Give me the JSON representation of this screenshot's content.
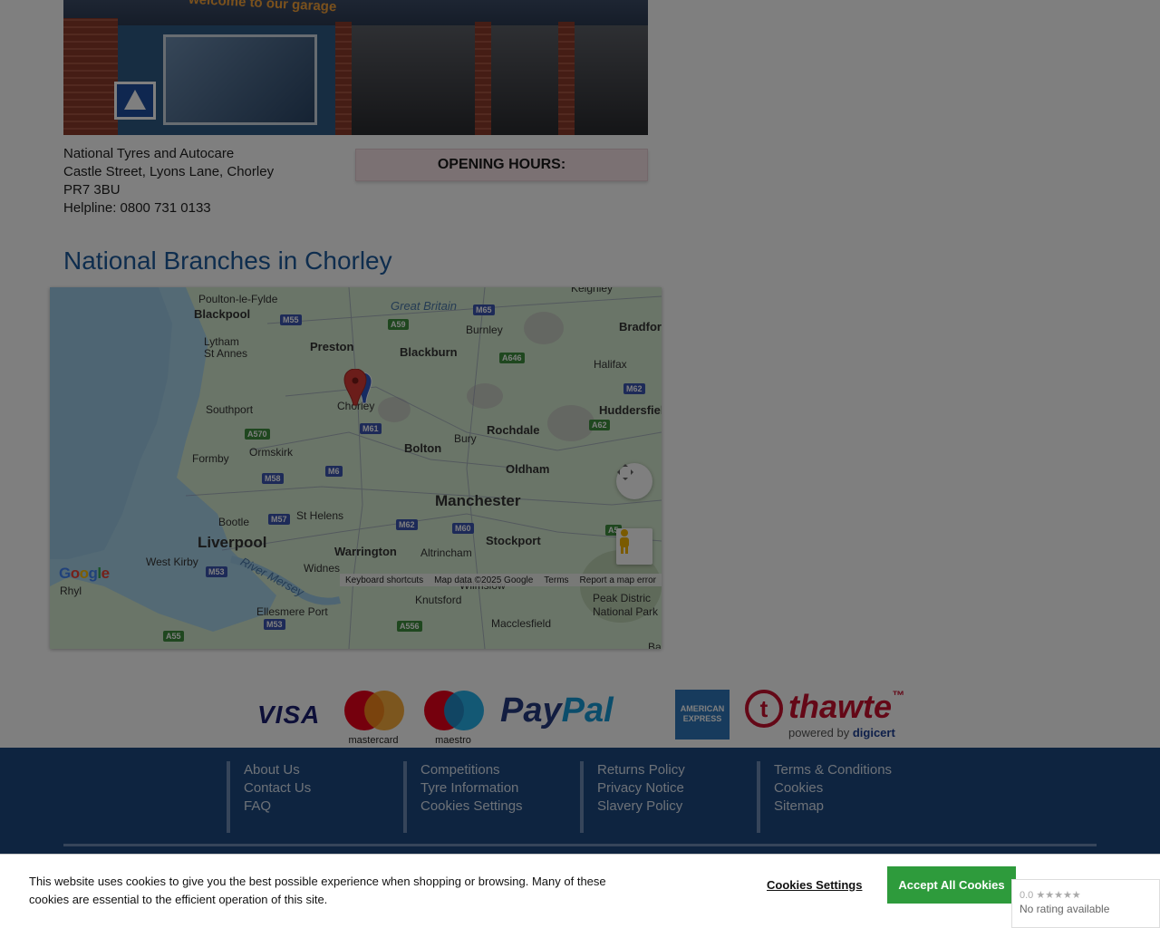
{
  "store": {
    "photo_sign": "welcome to our garage",
    "name": "National Tyres and Autocare",
    "street": "Castle Street, Lyons Lane, Chorley",
    "postcode": "PR7 3BU",
    "helpline": "Helpline: 0800 731 0133",
    "opening_hours_label": "OPENING HOURS:"
  },
  "branches_heading": "National Branches in Chorley",
  "map": {
    "places": {
      "poulton": "Poulton-le-Fylde",
      "great_britain": "Great Britain",
      "keighley": "Keighley",
      "blackpool": "Blackpool",
      "burnley": "Burnley",
      "bradford": "Bradford",
      "lytham": "Lytham\nSt Annes",
      "preston": "Preston",
      "blackburn": "Blackburn",
      "halifax": "Halifax",
      "southport": "Southport",
      "chorley": "Chorley",
      "huddersfield": "Huddersfiel",
      "rochdale": "Rochdale",
      "bury": "Bury",
      "ormskirk": "Ormskirk",
      "bolton": "Bolton",
      "formby": "Formby",
      "oldham": "Oldham",
      "manchester": "Manchester",
      "bootle": "Bootle",
      "st_helens": "St Helens",
      "liverpool": "Liverpool",
      "stockport": "Stockport",
      "warrington": "Warrington",
      "west_kirby": "West Kirby",
      "widnes": "Widnes",
      "altrincham": "Altrincham",
      "river_mersey": "River Mersey",
      "wilmslow": "Wilmslow",
      "rhyl": "Rhyl",
      "knutsford": "Knutsford",
      "peak_district": "Peak Distric\nNational Park",
      "ellesmere_port": "Ellesmere Port",
      "macclesfield": "Macclesfield",
      "ba": "Ba"
    },
    "roads": {
      "m55": "M55",
      "a59": "A59",
      "m65": "M65",
      "a646": "A646",
      "m62_a": "M62",
      "a570": "A570",
      "m61": "M61",
      "a62": "A62",
      "m58": "M58",
      "m6": "M6",
      "m57": "M57",
      "m62_b": "M62",
      "m60": "M60",
      "a5": "A5",
      "m53_a": "M53",
      "m53_b": "M53",
      "a556": "A556",
      "a55": "A55"
    },
    "google_logo": "Google",
    "footer": {
      "shortcuts": "Keyboard shortcuts",
      "data": "Map data ©2025 Google",
      "terms": "Terms",
      "report": "Report a map error"
    }
  },
  "payments": {
    "visa": "VISA",
    "mastercard": "mastercard",
    "maestro": "maestro",
    "paypal_pay": "Pay",
    "paypal_pal": "Pal",
    "amex": "AMERICAN EXPRESS",
    "thawte_t": "t",
    "thawte": "thawte",
    "thawte_tm": "™",
    "powered_by": "powered by",
    "digicert": "digicert"
  },
  "footer": {
    "col1": [
      "About Us",
      "Contact Us",
      "FAQ"
    ],
    "col2": [
      "Competitions",
      "Tyre Information",
      "Cookies Settings"
    ],
    "col3": [
      "Returns Policy",
      "Privacy Notice",
      "Slavery Policy"
    ],
    "col4": [
      "Terms & Conditions",
      "Cookies",
      "Sitemap"
    ]
  },
  "cookie_banner": {
    "message": "This website uses cookies to give you the best possible experience when shopping or browsing. Many of these cookies are essential to the efficient operation of this site.",
    "settings_label": "Cookies Settings",
    "accept_label": "Accept All Cookies"
  },
  "rating": {
    "score": "0.0",
    "stars": "★★★★★",
    "text": "No rating available"
  },
  "colors": {
    "footer_bg": "#1d4880",
    "heading": "#1d5a9c",
    "accept_green": "#2e9b3c"
  }
}
